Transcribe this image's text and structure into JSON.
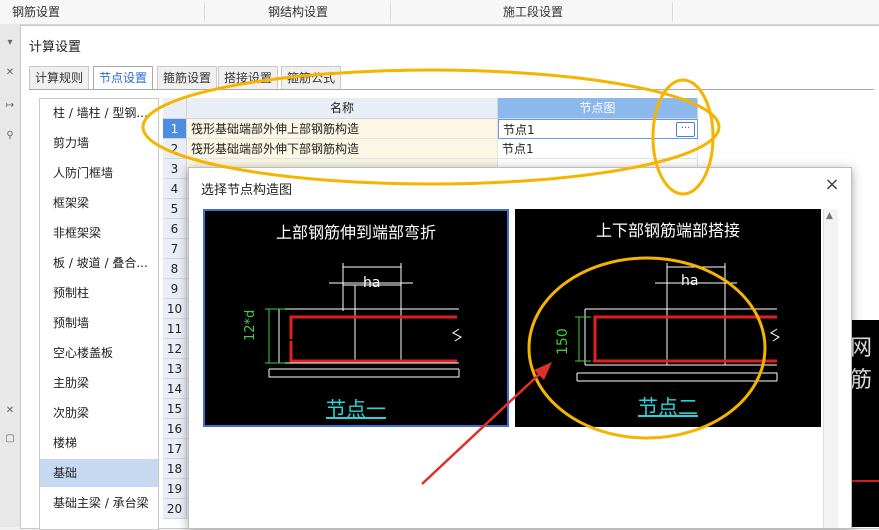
{
  "topbar": {
    "tabs": [
      "钢筋设置",
      "钢结构设置",
      "施工段设置"
    ]
  },
  "window": {
    "title": "计算设置",
    "tabs": [
      "计算规则",
      "节点设置",
      "箍筋设置",
      "搭接设置",
      "箍筋公式"
    ],
    "active_tab": "节点设置"
  },
  "categories": {
    "items": [
      "柱 / 墙柱 / 型钢...",
      "剪力墙",
      "人防门框墙",
      "框架梁",
      "非框架梁",
      "板 / 坡道 / 叠合...",
      "预制柱",
      "预制墙",
      "空心楼盖板",
      "主肋梁",
      "次肋梁",
      "楼梯",
      "基础",
      "基础主梁 / 承台梁"
    ],
    "selected": "基础"
  },
  "grid": {
    "headers": {
      "name": "名称",
      "node": "节点图"
    },
    "rows": [
      {
        "no": "1",
        "name": "筏形基础端部外伸上部钢筋构造",
        "node": "节点1"
      },
      {
        "no": "2",
        "name": "筏形基础端部外伸下部钢筋构造",
        "node": "节点1"
      },
      {
        "no": "3",
        "name": "",
        "node": ""
      },
      {
        "no": "4"
      },
      {
        "no": "5"
      },
      {
        "no": "6"
      },
      {
        "no": "7"
      },
      {
        "no": "8"
      },
      {
        "no": "9"
      },
      {
        "no": "10"
      },
      {
        "no": "11"
      },
      {
        "no": "12"
      },
      {
        "no": "13"
      },
      {
        "no": "14"
      },
      {
        "no": "15"
      },
      {
        "no": "16"
      },
      {
        "no": "17"
      },
      {
        "no": "18"
      },
      {
        "no": "19"
      },
      {
        "no": "20"
      }
    ],
    "ellipsis_button": "···"
  },
  "dialog": {
    "title": "选择节点构造图",
    "close": "×",
    "nodes": [
      {
        "title": "上部钢筋伸到端部弯折",
        "dim_label": "12*d",
        "ha_label": "ha",
        "caption": "节点一"
      },
      {
        "title": "上下部钢筋端部搭接",
        "dim_label": "150",
        "ha_label": "ha",
        "caption": "节点二"
      }
    ]
  },
  "preview": {
    "text": "网筋"
  },
  "colors": {
    "accent": "#3d6ed4",
    "annotation": "#f5b400",
    "rebar": "#e01f1f",
    "dim_green": "#3fcf3f",
    "caption_cyan": "#27d5d9"
  }
}
